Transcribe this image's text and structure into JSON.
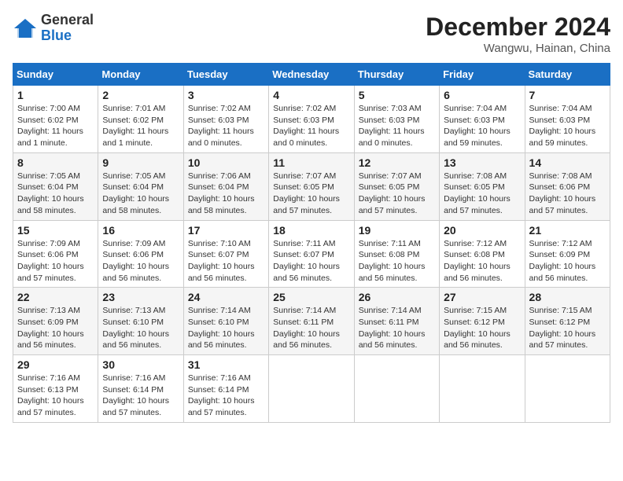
{
  "header": {
    "logo": {
      "general": "General",
      "blue": "Blue"
    },
    "title": "December 2024",
    "location": "Wangwu, Hainan, China"
  },
  "weekdays": [
    "Sunday",
    "Monday",
    "Tuesday",
    "Wednesday",
    "Thursday",
    "Friday",
    "Saturday"
  ],
  "weeks": [
    [
      {
        "day": 1,
        "info": "Sunrise: 7:00 AM\nSunset: 6:02 PM\nDaylight: 11 hours\nand 1 minute."
      },
      {
        "day": 2,
        "info": "Sunrise: 7:01 AM\nSunset: 6:02 PM\nDaylight: 11 hours\nand 1 minute."
      },
      {
        "day": 3,
        "info": "Sunrise: 7:02 AM\nSunset: 6:03 PM\nDaylight: 11 hours\nand 0 minutes."
      },
      {
        "day": 4,
        "info": "Sunrise: 7:02 AM\nSunset: 6:03 PM\nDaylight: 11 hours\nand 0 minutes."
      },
      {
        "day": 5,
        "info": "Sunrise: 7:03 AM\nSunset: 6:03 PM\nDaylight: 11 hours\nand 0 minutes."
      },
      {
        "day": 6,
        "info": "Sunrise: 7:04 AM\nSunset: 6:03 PM\nDaylight: 10 hours\nand 59 minutes."
      },
      {
        "day": 7,
        "info": "Sunrise: 7:04 AM\nSunset: 6:03 PM\nDaylight: 10 hours\nand 59 minutes."
      }
    ],
    [
      {
        "day": 8,
        "info": "Sunrise: 7:05 AM\nSunset: 6:04 PM\nDaylight: 10 hours\nand 58 minutes."
      },
      {
        "day": 9,
        "info": "Sunrise: 7:05 AM\nSunset: 6:04 PM\nDaylight: 10 hours\nand 58 minutes."
      },
      {
        "day": 10,
        "info": "Sunrise: 7:06 AM\nSunset: 6:04 PM\nDaylight: 10 hours\nand 58 minutes."
      },
      {
        "day": 11,
        "info": "Sunrise: 7:07 AM\nSunset: 6:05 PM\nDaylight: 10 hours\nand 57 minutes."
      },
      {
        "day": 12,
        "info": "Sunrise: 7:07 AM\nSunset: 6:05 PM\nDaylight: 10 hours\nand 57 minutes."
      },
      {
        "day": 13,
        "info": "Sunrise: 7:08 AM\nSunset: 6:05 PM\nDaylight: 10 hours\nand 57 minutes."
      },
      {
        "day": 14,
        "info": "Sunrise: 7:08 AM\nSunset: 6:06 PM\nDaylight: 10 hours\nand 57 minutes."
      }
    ],
    [
      {
        "day": 15,
        "info": "Sunrise: 7:09 AM\nSunset: 6:06 PM\nDaylight: 10 hours\nand 57 minutes."
      },
      {
        "day": 16,
        "info": "Sunrise: 7:09 AM\nSunset: 6:06 PM\nDaylight: 10 hours\nand 56 minutes."
      },
      {
        "day": 17,
        "info": "Sunrise: 7:10 AM\nSunset: 6:07 PM\nDaylight: 10 hours\nand 56 minutes."
      },
      {
        "day": 18,
        "info": "Sunrise: 7:11 AM\nSunset: 6:07 PM\nDaylight: 10 hours\nand 56 minutes."
      },
      {
        "day": 19,
        "info": "Sunrise: 7:11 AM\nSunset: 6:08 PM\nDaylight: 10 hours\nand 56 minutes."
      },
      {
        "day": 20,
        "info": "Sunrise: 7:12 AM\nSunset: 6:08 PM\nDaylight: 10 hours\nand 56 minutes."
      },
      {
        "day": 21,
        "info": "Sunrise: 7:12 AM\nSunset: 6:09 PM\nDaylight: 10 hours\nand 56 minutes."
      }
    ],
    [
      {
        "day": 22,
        "info": "Sunrise: 7:13 AM\nSunset: 6:09 PM\nDaylight: 10 hours\nand 56 minutes."
      },
      {
        "day": 23,
        "info": "Sunrise: 7:13 AM\nSunset: 6:10 PM\nDaylight: 10 hours\nand 56 minutes."
      },
      {
        "day": 24,
        "info": "Sunrise: 7:14 AM\nSunset: 6:10 PM\nDaylight: 10 hours\nand 56 minutes."
      },
      {
        "day": 25,
        "info": "Sunrise: 7:14 AM\nSunset: 6:11 PM\nDaylight: 10 hours\nand 56 minutes."
      },
      {
        "day": 26,
        "info": "Sunrise: 7:14 AM\nSunset: 6:11 PM\nDaylight: 10 hours\nand 56 minutes."
      },
      {
        "day": 27,
        "info": "Sunrise: 7:15 AM\nSunset: 6:12 PM\nDaylight: 10 hours\nand 56 minutes."
      },
      {
        "day": 28,
        "info": "Sunrise: 7:15 AM\nSunset: 6:12 PM\nDaylight: 10 hours\nand 57 minutes."
      }
    ],
    [
      {
        "day": 29,
        "info": "Sunrise: 7:16 AM\nSunset: 6:13 PM\nDaylight: 10 hours\nand 57 minutes."
      },
      {
        "day": 30,
        "info": "Sunrise: 7:16 AM\nSunset: 6:14 PM\nDaylight: 10 hours\nand 57 minutes."
      },
      {
        "day": 31,
        "info": "Sunrise: 7:16 AM\nSunset: 6:14 PM\nDaylight: 10 hours\nand 57 minutes."
      },
      null,
      null,
      null,
      null
    ]
  ]
}
